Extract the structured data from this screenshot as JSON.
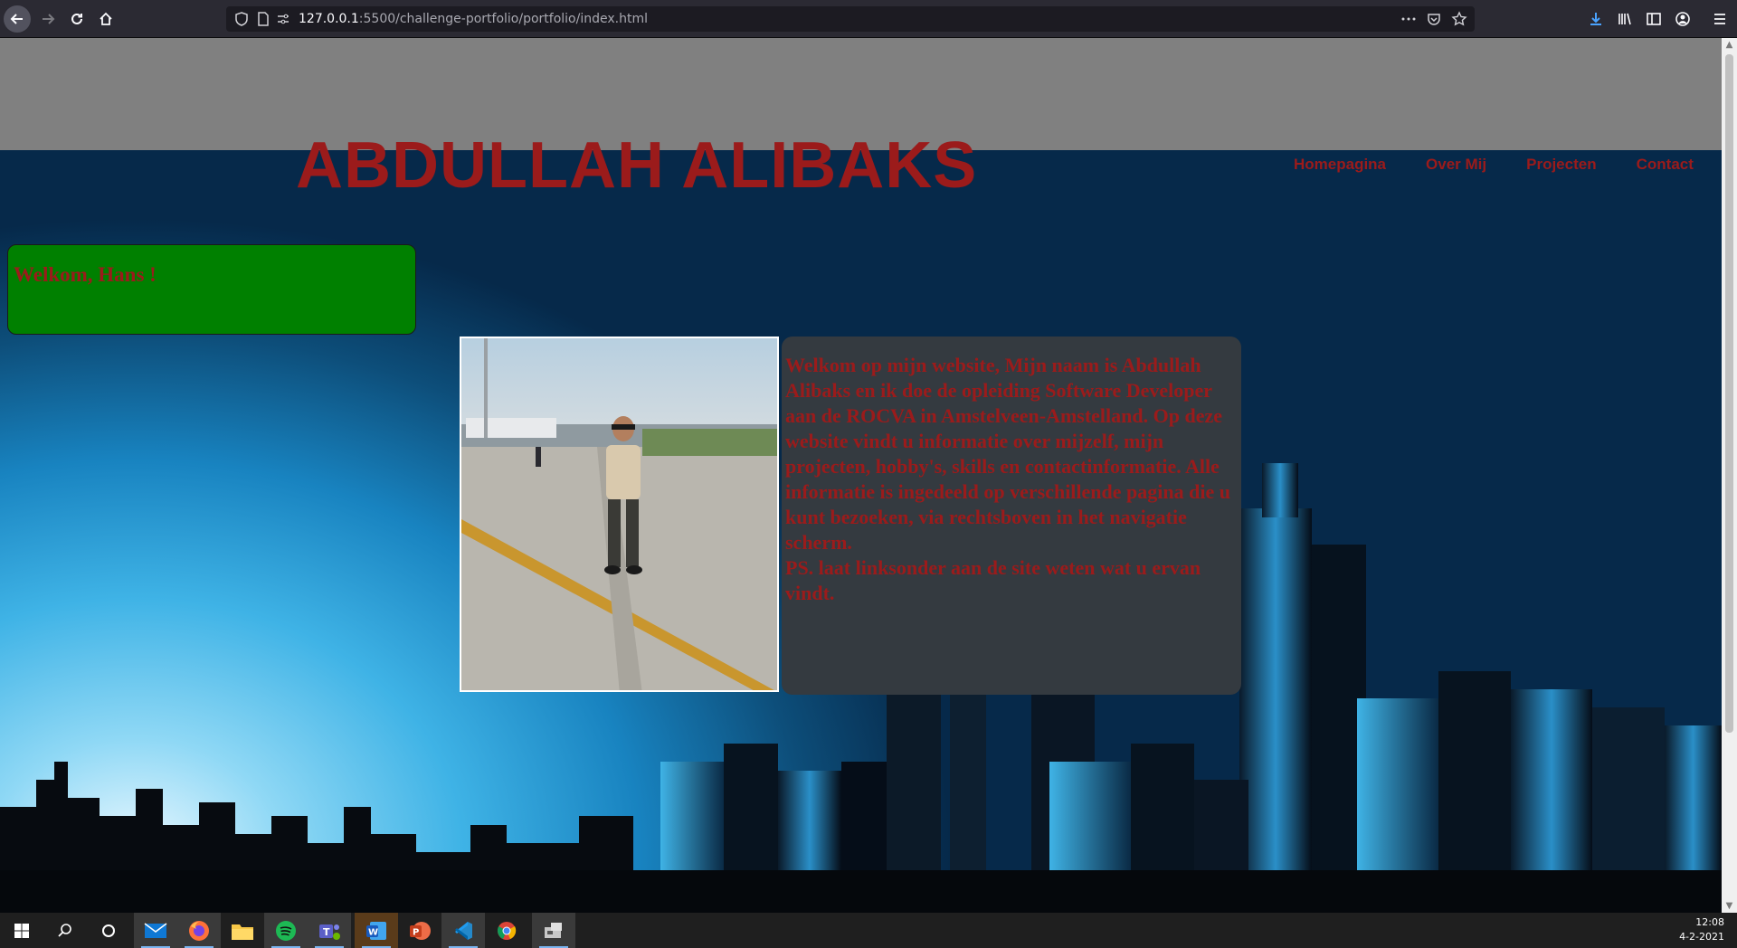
{
  "browser": {
    "url_host": "127.0.0.1",
    "url_path": ":5500/challenge-portfolio/portfolio/index.html"
  },
  "page": {
    "title": "ABDULLAH ALIBAKS",
    "nav": [
      "Homepagina",
      "Over Mij",
      "Projecten",
      "Contact"
    ],
    "welcome": "Welkom, Hans !",
    "intro": "Welkom op mijn website, Mijn naam is Abdullah Alibaks en ik doe de opleiding Software Developer aan de ROCVA in Amstelveen-Amstelland. Op deze website vindt u informatie over mijzelf, mijn projecten, hobby's, skills en contactinformatie. Alle informatie is ingedeeld op verschillende pagina die u kunt bezoeken, via rechtsboven in het navigatie scherm.",
    "intro_ps": "PS. laat linksonder aan de site weten wat u ervan vindt."
  },
  "colors": {
    "accent_text": "#9b1b1b",
    "welcome_bg": "#008000",
    "intro_bg": "#343a40",
    "header_band": "#808080"
  },
  "taskbar": {
    "apps": [
      "mail-icon",
      "firefox-icon",
      "file-explorer-icon",
      "spotify-icon",
      "teams-icon",
      "word-icon",
      "powerpoint-icon",
      "vscode-icon",
      "chrome-icon",
      "devices-icon"
    ],
    "time": "12:08",
    "date": "4-2-2021"
  }
}
